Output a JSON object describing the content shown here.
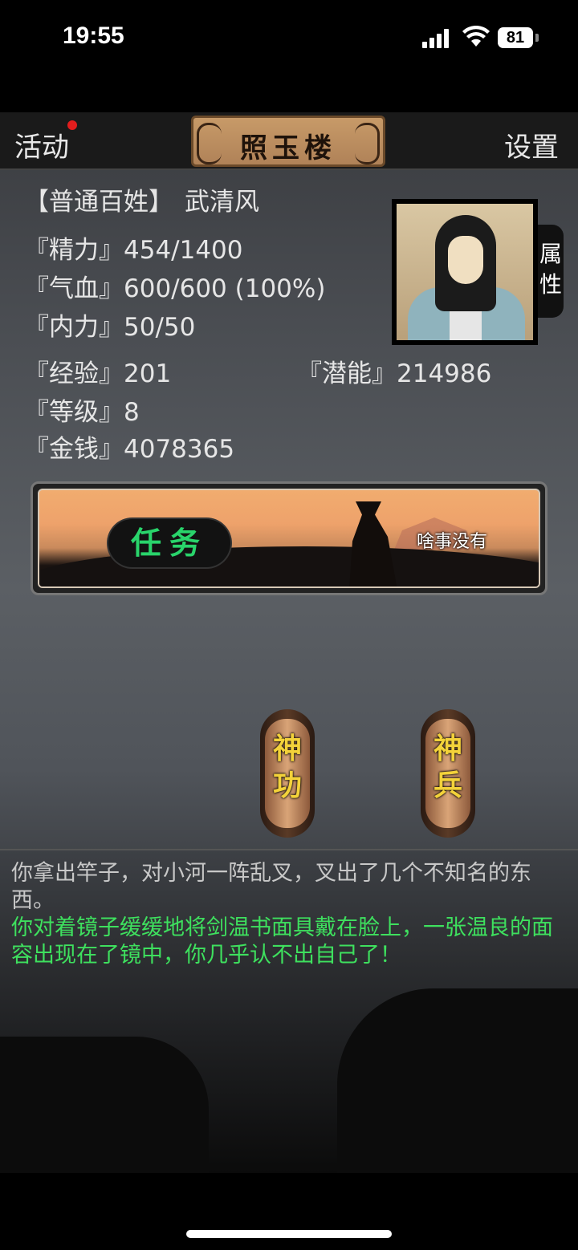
{
  "status_bar": {
    "time": "19:55",
    "battery": "81"
  },
  "nav": {
    "activity": "活动",
    "title": "照玉楼",
    "settings": "设置",
    "attributes_tab": "属性"
  },
  "character": {
    "class": "【普通百姓】",
    "name": "武清风",
    "stats": [
      {
        "label": "『精力』",
        "value": "454/1400"
      },
      {
        "label": "『气血』",
        "value": "600/600 (100%)"
      },
      {
        "label": "『内力』",
        "value": "50/50"
      },
      {
        "label": "『经验』",
        "value": "201"
      },
      {
        "label": "『潜能』",
        "value": "214986"
      },
      {
        "label": "『等级』",
        "value": "8"
      },
      {
        "label": "『金钱』",
        "value": "4078365"
      }
    ]
  },
  "task": {
    "label": "任务",
    "status": "啥事没有"
  },
  "buttons": {
    "shengong": {
      "line1": "神",
      "line2": "功"
    },
    "shenbing": {
      "line1": "神",
      "line2": "兵"
    }
  },
  "log": [
    {
      "text": "你拿出竿子，对小河一阵乱叉，叉出了几个不知名的东西。",
      "color": "#c8c8c8"
    },
    {
      "text": "你对着镜子缓缓地将剑温书面具戴在脸上，一张温良的面容出现在了镜中，你几乎认不出自己了！",
      "color": "#3ee05e"
    }
  ],
  "colors": {
    "accent_green": "#3ee05e",
    "notification_red": "#e21d1d",
    "scroll_text": "#f3d23a"
  }
}
